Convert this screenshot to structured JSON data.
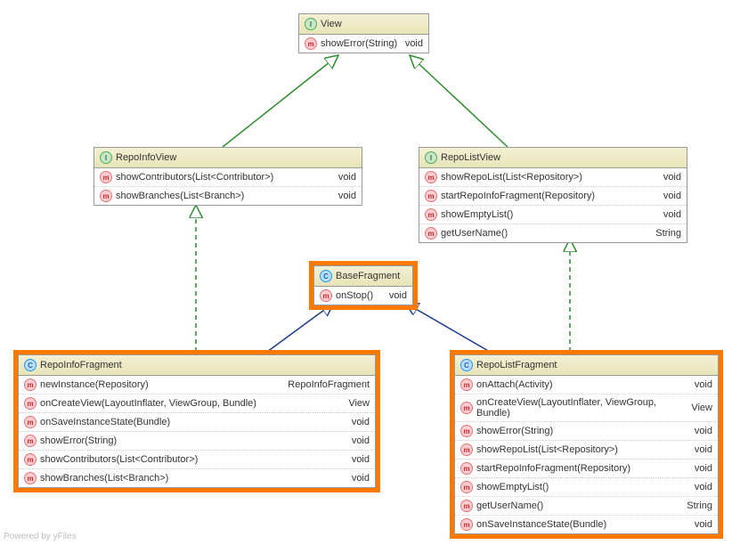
{
  "nodes": {
    "view": {
      "type": "I",
      "name": "View",
      "methods": [
        {
          "sig": "showError(String)",
          "ret": "void"
        }
      ]
    },
    "repoInfoView": {
      "type": "I",
      "name": "RepoInfoView",
      "methods": [
        {
          "sig": "showContributors(List<Contributor>)",
          "ret": "void"
        },
        {
          "sig": "showBranches(List<Branch>)",
          "ret": "void"
        }
      ]
    },
    "repoListView": {
      "type": "I",
      "name": "RepoListView",
      "methods": [
        {
          "sig": "showRepoList(List<Repository>)",
          "ret": "void"
        },
        {
          "sig": "startRepoInfoFragment(Repository)",
          "ret": "void"
        },
        {
          "sig": "showEmptyList()",
          "ret": "void"
        },
        {
          "sig": "getUserName()",
          "ret": "String"
        }
      ]
    },
    "baseFragment": {
      "type": "C",
      "name": "BaseFragment",
      "methods": [
        {
          "sig": "onStop()",
          "ret": "void"
        }
      ]
    },
    "repoInfoFragment": {
      "type": "C",
      "name": "RepoInfoFragment",
      "methods": [
        {
          "sig": "newInstance(Repository)",
          "ret": "RepoInfoFragment"
        },
        {
          "sig": "onCreateView(LayoutInflater, ViewGroup, Bundle)",
          "ret": "View"
        },
        {
          "sig": "onSaveInstanceState(Bundle)",
          "ret": "void"
        },
        {
          "sig": "showError(String)",
          "ret": "void"
        },
        {
          "sig": "showContributors(List<Contributor>)",
          "ret": "void"
        },
        {
          "sig": "showBranches(List<Branch>)",
          "ret": "void"
        }
      ]
    },
    "repoListFragment": {
      "type": "C",
      "name": "RepoListFragment",
      "methods": [
        {
          "sig": "onAttach(Activity)",
          "ret": "void"
        },
        {
          "sig": "onCreateView(LayoutInflater, ViewGroup, Bundle)",
          "ret": "View"
        },
        {
          "sig": "showError(String)",
          "ret": "void"
        },
        {
          "sig": "showRepoList(List<Repository>)",
          "ret": "void"
        },
        {
          "sig": "startRepoInfoFragment(Repository)",
          "ret": "void"
        },
        {
          "sig": "showEmptyList()",
          "ret": "void"
        },
        {
          "sig": "getUserName()",
          "ret": "String"
        },
        {
          "sig": "onSaveInstanceState(Bundle)",
          "ret": "void"
        }
      ]
    }
  },
  "footer": "Powered by yFiles"
}
